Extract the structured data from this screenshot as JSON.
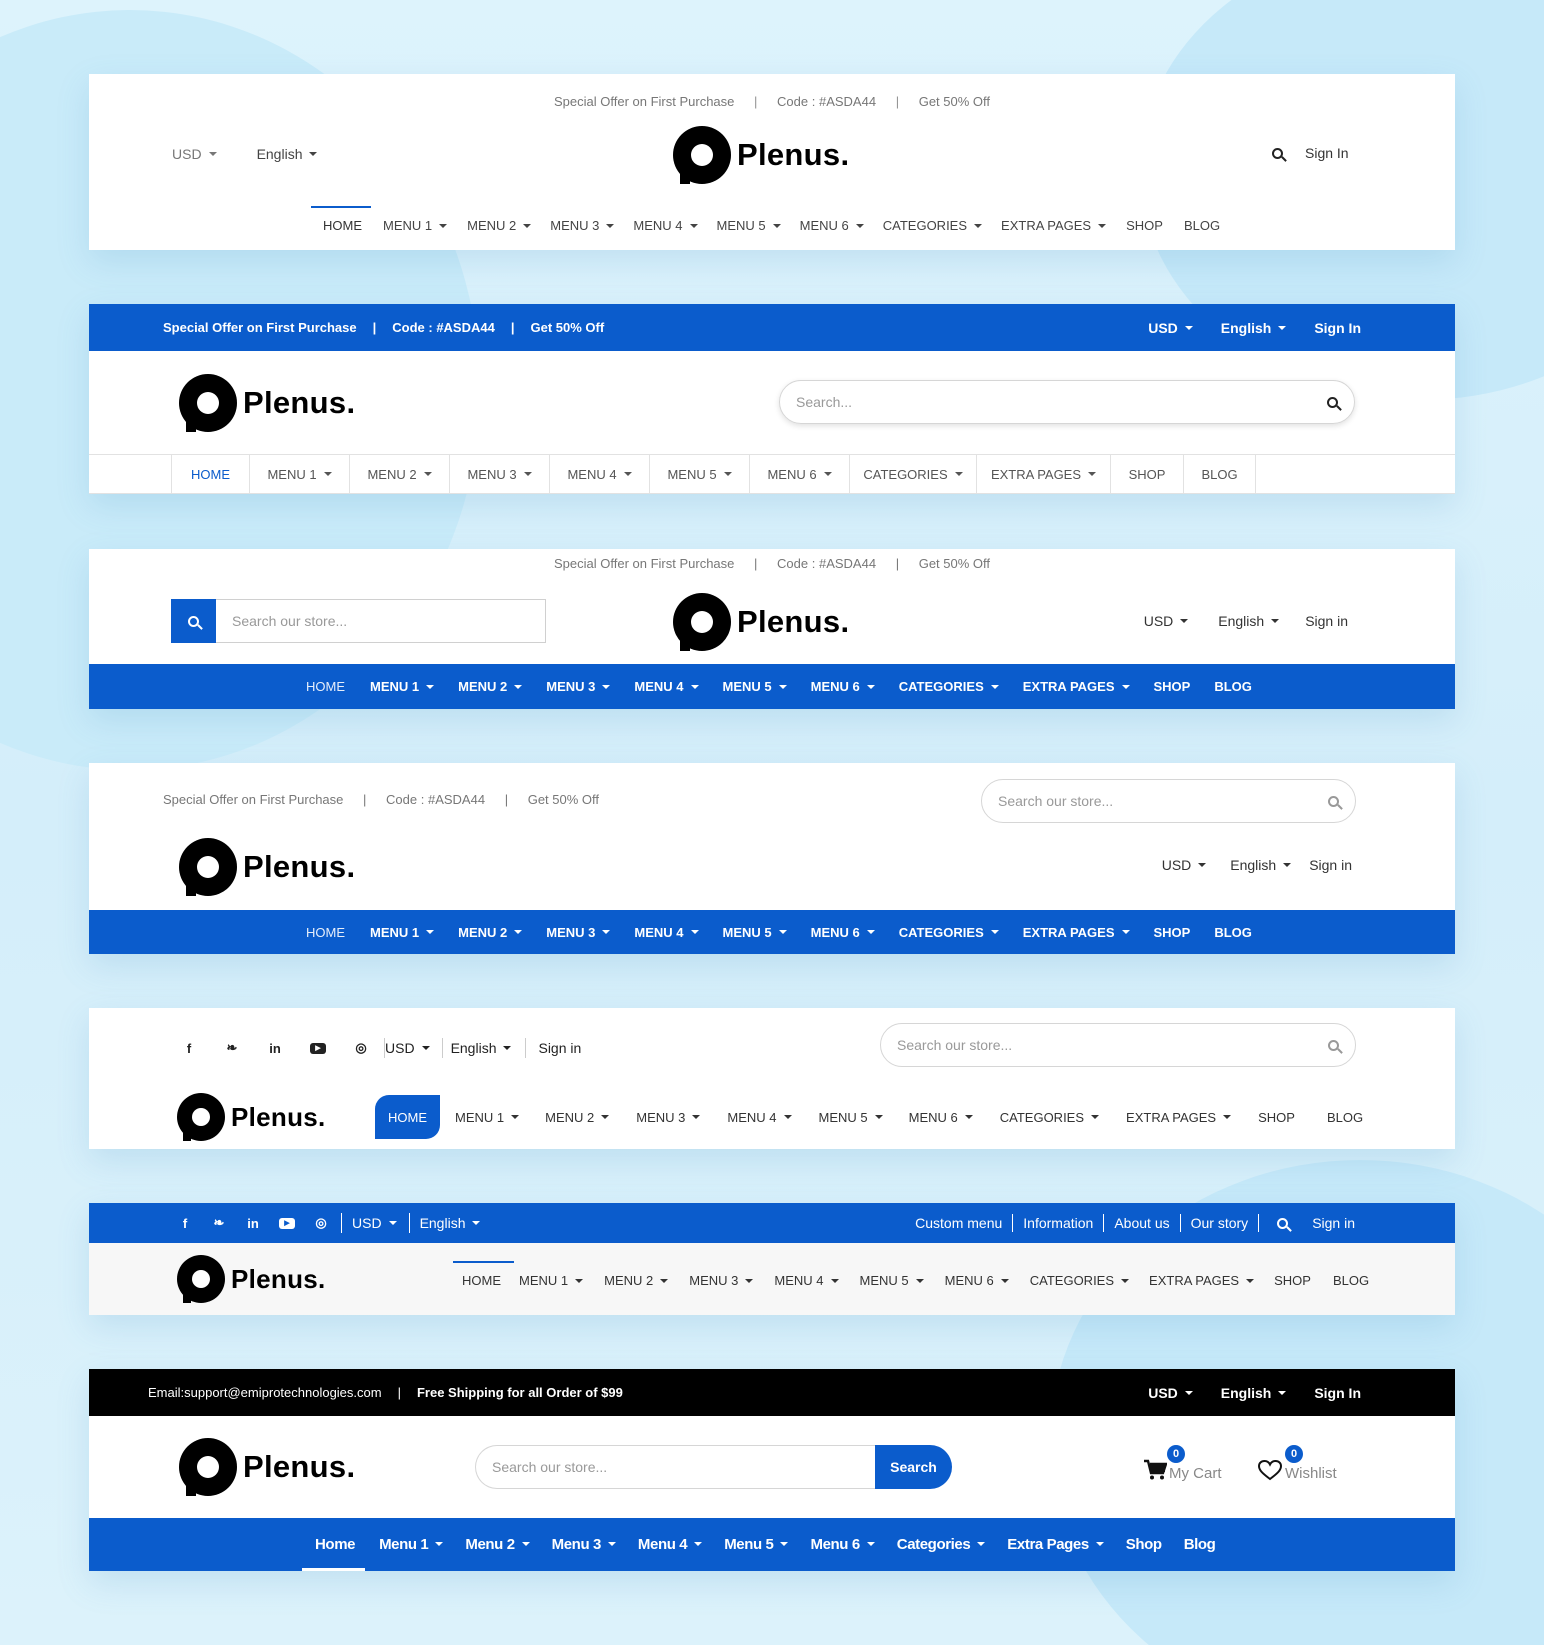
{
  "brand": "Plenus.",
  "currency": "USD",
  "language": "English",
  "colors": {
    "accent": "#0b5ccc",
    "dark": "#000000",
    "text": "#333333"
  },
  "promo": {
    "offer": "Special Offer on First Purchase",
    "code": "Code : #ASDA44",
    "discount": "Get 50% Off",
    "sep": "|"
  },
  "menu_upper": [
    "HOME",
    "MENU 1",
    "MENU 2",
    "MENU 3",
    "MENU 4",
    "MENU 5",
    "MENU 6",
    "CATEGORIES",
    "EXTRA PAGES",
    "SHOP",
    "BLOG"
  ],
  "menu_title": [
    "Home",
    "Menu 1",
    "Menu 2",
    "Menu 3",
    "Menu 4",
    "Menu 5",
    "Menu 6",
    "Categories",
    "Extra Pages",
    "Shop",
    "Blog"
  ],
  "dropdown_items": [
    false,
    true,
    true,
    true,
    true,
    true,
    true,
    true,
    true,
    false,
    false
  ],
  "signin": {
    "sign_in_cap": "Sign In",
    "sign_in_lower": "Sign in"
  },
  "search": {
    "short": "Search...",
    "store": "Search our store...",
    "button": "Search"
  },
  "social_icons": [
    "facebook-icon",
    "twitter-icon",
    "linkedin-icon",
    "youtube-icon",
    "github-icon"
  ],
  "header6": {
    "links": [
      "Custom menu",
      "Information",
      "About us",
      "Our story"
    ]
  },
  "header7": {
    "email_label": "Email:",
    "email": "support@emiprotechnologies.com",
    "shipping": "Free Shipping for all Order of $99",
    "cart_label": "My Cart",
    "cart_count": "0",
    "wishlist_label": "Wishlist",
    "wishlist_count": "0"
  }
}
